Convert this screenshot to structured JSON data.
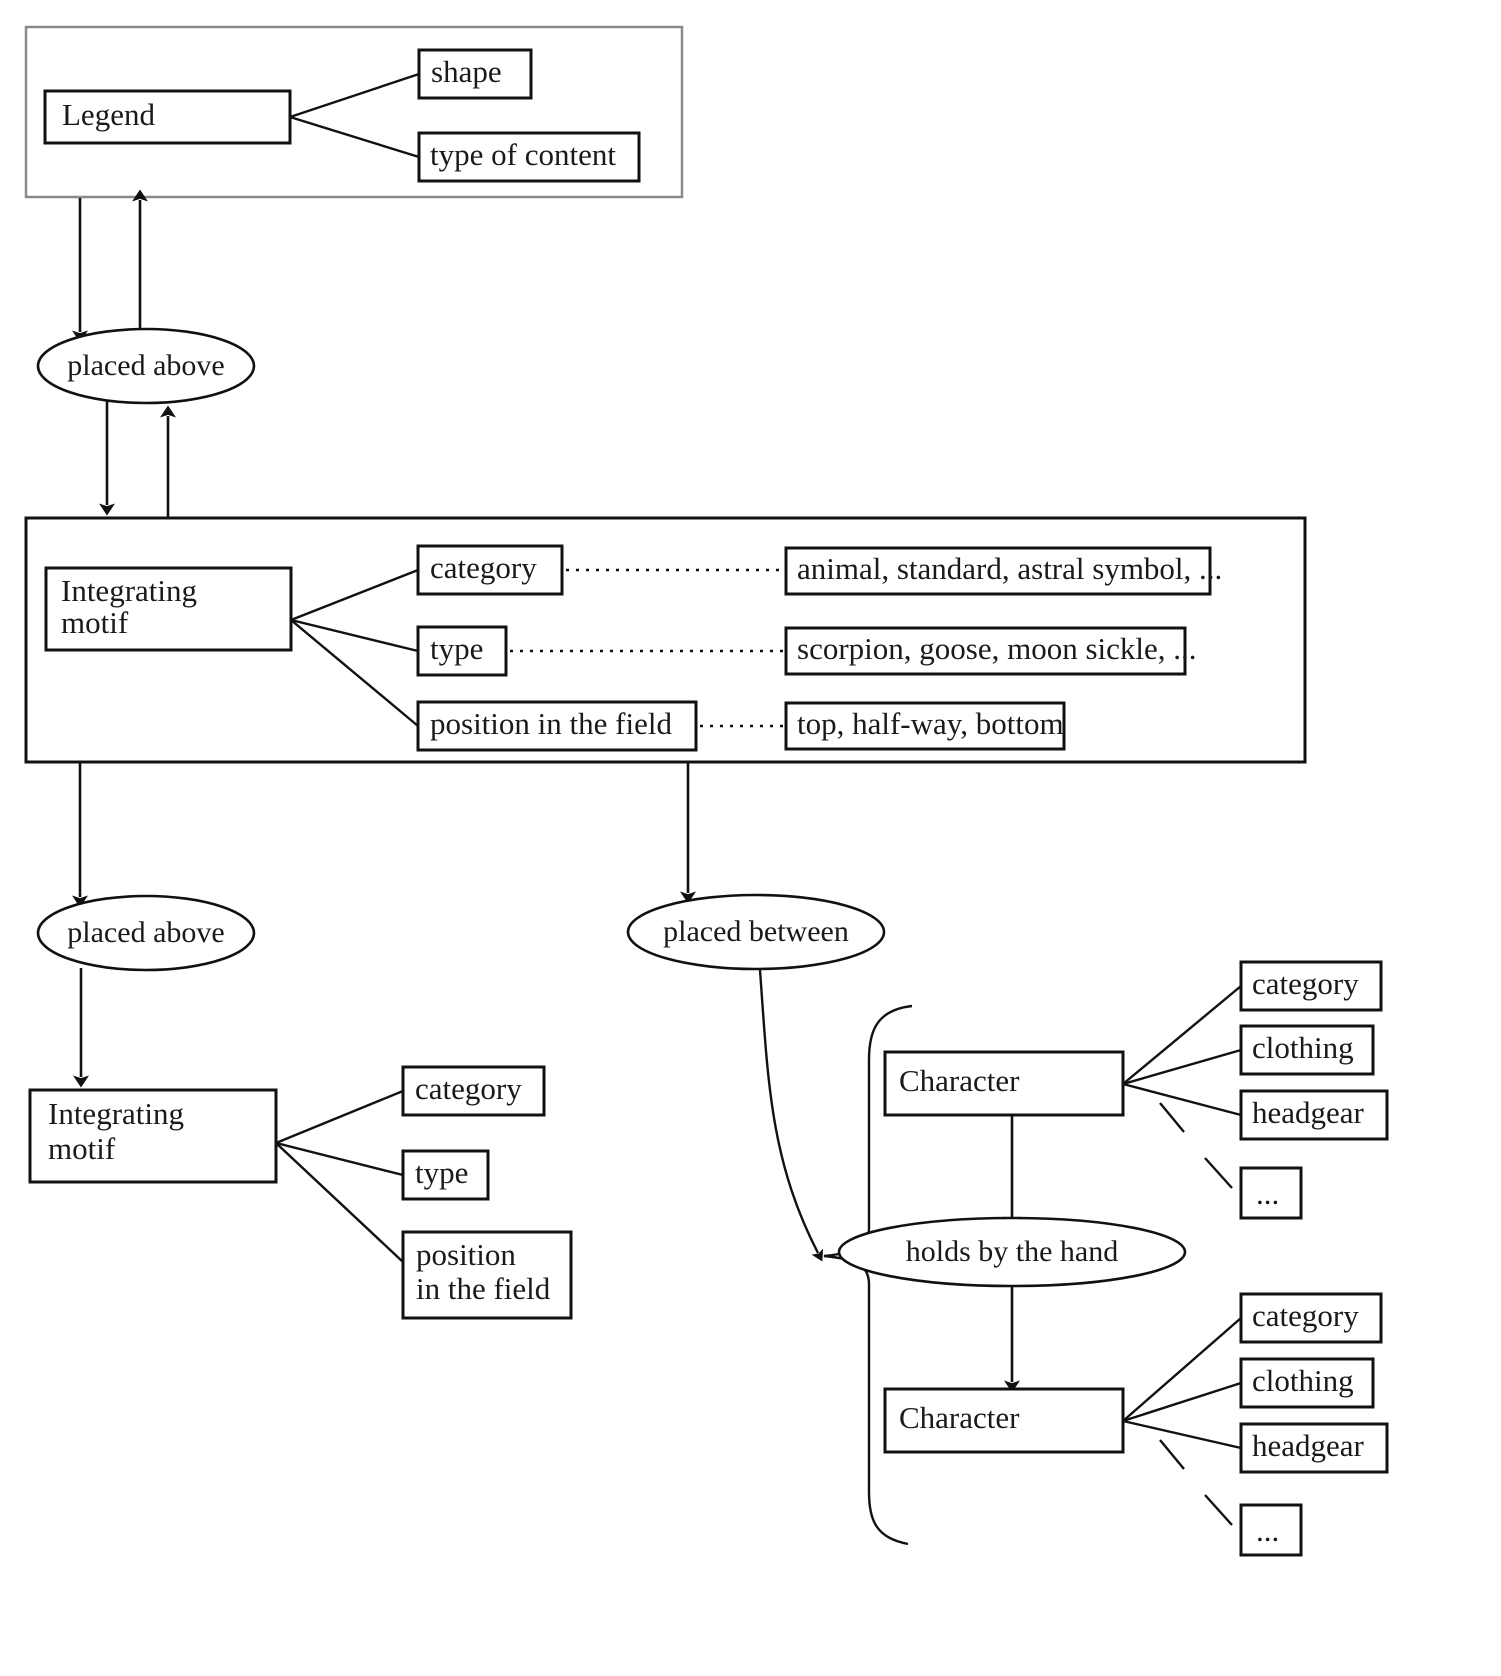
{
  "diagram": {
    "title": "Legend / Integrating motif / Character knowledge graph schema",
    "colors": {
      "stroke": "#111111",
      "frame": "#8a8a8a",
      "background": "#ffffff",
      "text": "#1a1a1a"
    },
    "legend_group": {
      "entity": "Legend",
      "attributes": [
        {
          "label": "shape"
        },
        {
          "label": "type of content"
        }
      ]
    },
    "relations": {
      "placed_above_top": "placed above",
      "placed_above_lower": "placed above",
      "placed_between": "placed between",
      "holds_by_the_hand": "holds by the hand"
    },
    "motif_group": {
      "entity_line1": "Integrating",
      "entity_line2": "motif",
      "attributes": [
        {
          "label": "category",
          "values": "animal, standard, astral symbol, ..."
        },
        {
          "label": "type",
          "values": "scorpion, goose, moon sickle, ..."
        },
        {
          "label": "position in the field",
          "values": "top, half-way, bottom"
        }
      ]
    },
    "motif_lower": {
      "entity_line1": "Integrating",
      "entity_line2": "motif",
      "attributes": [
        {
          "label": "category"
        },
        {
          "label": "type"
        },
        {
          "label_line1": "position",
          "label_line2": "in the field"
        }
      ]
    },
    "character_top": {
      "entity": "Character",
      "attributes": [
        {
          "label": "category"
        },
        {
          "label": "clothing"
        },
        {
          "label": "headgear"
        },
        {
          "label": "..."
        }
      ]
    },
    "character_bottom": {
      "entity": "Character",
      "attributes": [
        {
          "label": "category"
        },
        {
          "label": "clothing"
        },
        {
          "label": "headgear"
        },
        {
          "label": "..."
        }
      ]
    }
  }
}
